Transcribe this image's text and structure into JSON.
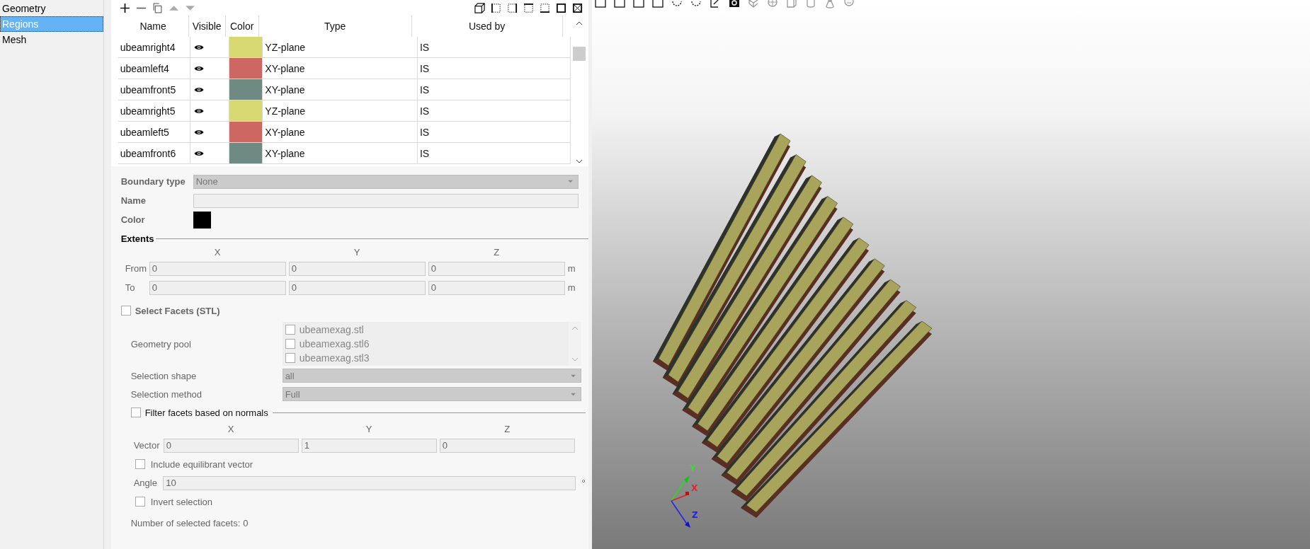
{
  "sidebar": {
    "items": [
      {
        "label": "Geometry",
        "selected": false
      },
      {
        "label": "Regions",
        "selected": true
      },
      {
        "label": "Mesh",
        "selected": false
      }
    ]
  },
  "table": {
    "columns": [
      "Name",
      "Visible",
      "Color",
      "Type",
      "Used by"
    ],
    "rows": [
      {
        "name": "ubeamright4",
        "visible": true,
        "color": "#d8d872",
        "type": "YZ-plane",
        "used_by": "IS"
      },
      {
        "name": "ubeamleft4",
        "visible": true,
        "color": "#cc6861",
        "type": "XY-plane",
        "used_by": "IS"
      },
      {
        "name": "ubeamfront5",
        "visible": true,
        "color": "#6e8a82",
        "type": "XY-plane",
        "used_by": "IS"
      },
      {
        "name": "ubeamright5",
        "visible": true,
        "color": "#d8d872",
        "type": "YZ-plane",
        "used_by": "IS"
      },
      {
        "name": "ubeamleft5",
        "visible": true,
        "color": "#cc6861",
        "type": "XY-plane",
        "used_by": "IS"
      },
      {
        "name": "ubeamfront6",
        "visible": true,
        "color": "#6e8a82",
        "type": "XY-plane",
        "used_by": "IS"
      }
    ]
  },
  "form": {
    "boundary_type": {
      "label": "Boundary type",
      "value": "None"
    },
    "name": {
      "label": "Name"
    },
    "color": {
      "label": "Color",
      "color": "#000000"
    },
    "extents": {
      "title": "Extents",
      "axes": [
        "X",
        "Y",
        "Z"
      ],
      "rows": [
        {
          "label": "From",
          "values": [
            "0",
            "0",
            "0"
          ],
          "unit": "m"
        },
        {
          "label": "To",
          "values": [
            "0",
            "0",
            "0"
          ],
          "unit": "m"
        }
      ]
    },
    "select_facets": {
      "label": "Select Facets (STL)",
      "checked": false
    },
    "geometry_pool": {
      "label": "Geometry pool",
      "items": [
        {
          "label": "ubeamexag.stl",
          "checked": false
        },
        {
          "label": "ubeamexag.stl6",
          "checked": false
        },
        {
          "label": "ubeamexag.stl3",
          "checked": false
        }
      ]
    },
    "selection_shape": {
      "label": "Selection shape",
      "value": "all"
    },
    "selection_method": {
      "label": "Selection method",
      "value": "Full"
    },
    "filter": {
      "label": "Filter facets based on normals",
      "checked": false
    },
    "vector": {
      "label": "Vector",
      "axes": [
        "X",
        "Y",
        "Z"
      ],
      "values": [
        "0",
        "1",
        "0"
      ]
    },
    "include_equilibrant": {
      "label": "Include equilibrant vector",
      "checked": false
    },
    "angle": {
      "label": "Angle",
      "value": "10",
      "unit": "°"
    },
    "invert": {
      "label": "Invert selection",
      "checked": false
    },
    "count": {
      "label": "Number of selected facets:",
      "value": "0"
    }
  },
  "viewport": {
    "axes": [
      "Y",
      "X",
      "Z"
    ]
  }
}
